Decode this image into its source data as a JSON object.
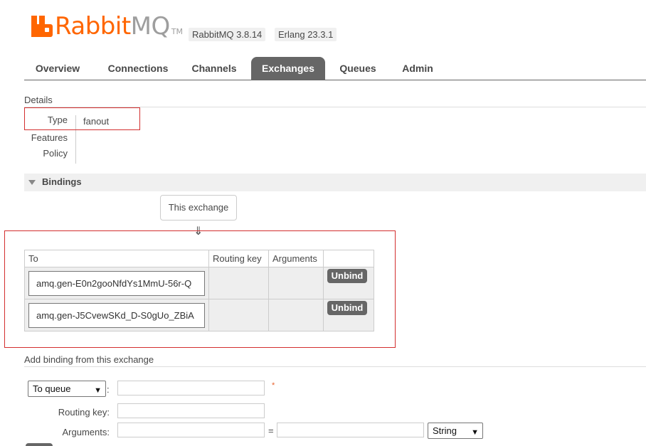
{
  "header": {
    "logo_rabbit": "Rabbit",
    "logo_mq": "MQ",
    "logo_tm": "TM",
    "rabbitmq_version": "RabbitMQ 3.8.14",
    "erlang_version": "Erlang 23.3.1"
  },
  "tabs": [
    {
      "label": "Overview",
      "active": false
    },
    {
      "label": "Connections",
      "active": false
    },
    {
      "label": "Channels",
      "active": false
    },
    {
      "label": "Exchanges",
      "active": true
    },
    {
      "label": "Queues",
      "active": false
    },
    {
      "label": "Admin",
      "active": false
    }
  ],
  "details": {
    "title": "Details",
    "type_label": "Type",
    "type_value": "fanout",
    "features_label": "Features",
    "policy_label": "Policy"
  },
  "bindings": {
    "title": "Bindings",
    "this_exchange": "This exchange",
    "arrow": "⇓",
    "columns": [
      "To",
      "Routing key",
      "Arguments",
      ""
    ],
    "rows": [
      {
        "to": "amq.gen-E0n2gooNfdYs1MmU-56r-Q",
        "routing_key": "",
        "arguments": "",
        "action": "Unbind"
      },
      {
        "to": "amq.gen-J5CvewSKd_D-S0gUo_ZBiA",
        "routing_key": "",
        "arguments": "",
        "action": "Unbind"
      }
    ]
  },
  "add_binding": {
    "title": "Add binding from this exchange",
    "destination_type": "To queue",
    "colon": ":",
    "required_mark": "*",
    "routing_key_label": "Routing key:",
    "arguments_label": "Arguments:",
    "equals": "=",
    "arg_type": "String"
  },
  "colors": {
    "brand_orange": "#ff6600",
    "tab_active": "#666666",
    "highlight_red": "#d32f2f"
  }
}
